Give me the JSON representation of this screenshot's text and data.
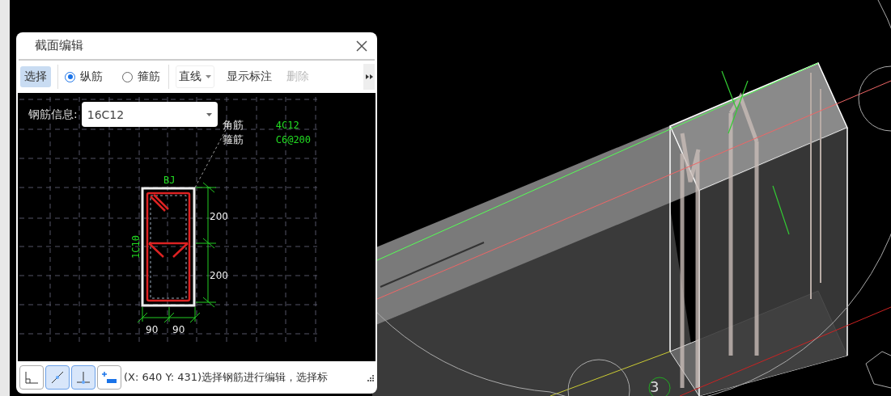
{
  "viewport": {
    "axis_label": "3"
  },
  "dialog": {
    "title": "截面编辑",
    "toolbar": [
      {
        "kind": "button",
        "label": "选择",
        "selected": true,
        "disabled": false
      },
      {
        "kind": "radio",
        "label": "纵筋",
        "selected": true
      },
      {
        "kind": "radio",
        "label": "箍筋",
        "selected": false
      },
      {
        "kind": "dropdown",
        "label": "直线"
      },
      {
        "kind": "button",
        "label": "显示标注",
        "selected": false,
        "disabled": false
      },
      {
        "kind": "button",
        "label": "删除",
        "selected": false,
        "disabled": true
      }
    ],
    "rebar_info": {
      "label": "钢筋信息:",
      "value": "16C12"
    },
    "legend": [
      {
        "name": "角筋",
        "value": "4C12"
      },
      {
        "name": "箍筋",
        "value": "C6@200"
      }
    ],
    "section": {
      "top_label": "BJ",
      "side_label": "1C10",
      "height_dims": [
        "200",
        "200"
      ],
      "width_dims": [
        "90",
        "90"
      ]
    },
    "snap_tools": [
      {
        "kind": "corner",
        "selected": false
      },
      {
        "kind": "line",
        "selected": true
      },
      {
        "kind": "perpendicular",
        "selected": true
      },
      {
        "kind": "add",
        "selected": false
      }
    ],
    "status": "(X: 640 Y: 431)选择钢筋进行编辑，选择标"
  }
}
